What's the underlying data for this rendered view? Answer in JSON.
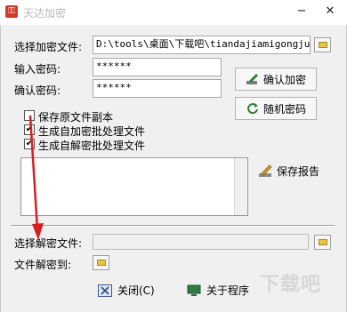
{
  "window": {
    "title": "天达加密",
    "minimize": "−",
    "close": "✕"
  },
  "encrypt": {
    "file_label": "选择加密文件:",
    "file_value": "D:\\tools\\桌面\\下载吧\\tiandajiamigongju\\",
    "password_label": "输入密码:",
    "password_value": "******",
    "confirm_label": "确认密码:",
    "confirm_value": "******",
    "confirm_button": "确认加密",
    "random_button": "随机密码"
  },
  "options": {
    "keep_original": {
      "label": "保存原文件副本",
      "checked": false
    },
    "gen_encrypt_batch": {
      "label": "生成自加密批处理文件",
      "checked": true
    },
    "gen_decrypt_batch": {
      "label": "生成自解密批处理文件",
      "checked": true
    }
  },
  "report": {
    "save_button": "保存报告"
  },
  "decrypt": {
    "file_label": "选择解密文件:",
    "file_value": "",
    "target_label": "文件解密到:"
  },
  "footer": {
    "close_button": "关闭(C)",
    "about_button": "关于程序"
  },
  "watermark": "下载吧"
}
